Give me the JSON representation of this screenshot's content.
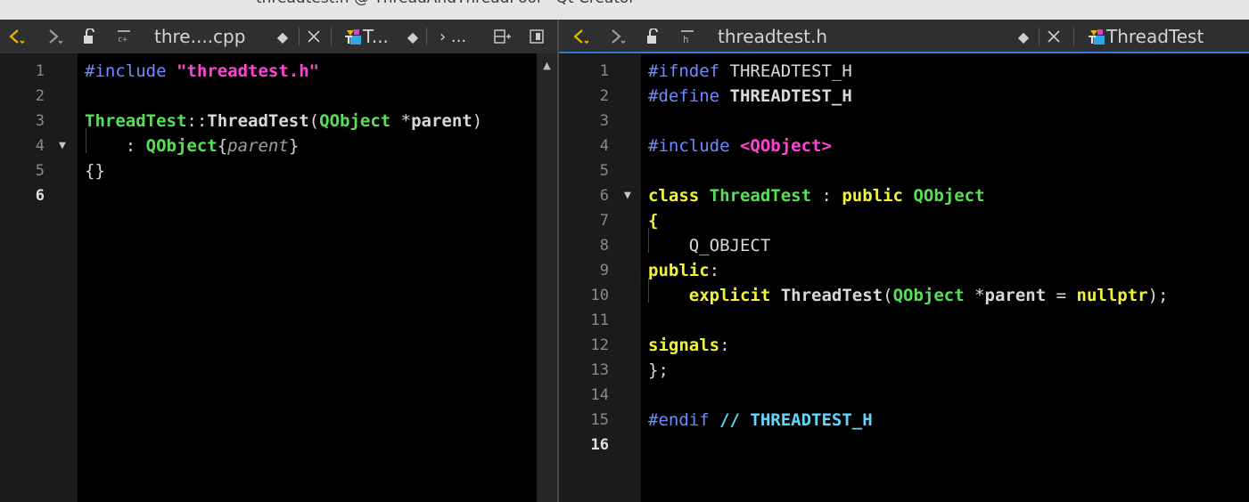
{
  "window": {
    "title": "threadtest.h @ ThreadAndThreadPool - Qt Creator"
  },
  "left_pane": {
    "toolbar": {
      "back_label": "⟨",
      "forward_label": "⟩",
      "file_name": "thre....cpp",
      "symbol_label": "T...",
      "breadcrumb_label": "› ...",
      "split_label": "⊞",
      "close_label": "✕"
    },
    "lines": [
      {
        "num": "1",
        "tokens": [
          {
            "c": "kw-pre",
            "t": "#include "
          },
          {
            "c": "kw-str",
            "t": "\"threadtest.h\""
          }
        ]
      },
      {
        "num": "2",
        "tokens": []
      },
      {
        "num": "3",
        "tokens": [
          {
            "c": "kw-type",
            "t": "ThreadTest"
          },
          {
            "c": "kw-op",
            "t": "::"
          },
          {
            "c": "kw-cls",
            "t": "ThreadTest"
          },
          {
            "c": "kw-op",
            "t": "("
          },
          {
            "c": "kw-type",
            "t": "QObject"
          },
          {
            "c": "kw-op",
            "t": " *"
          },
          {
            "c": "kw-cls",
            "t": "parent"
          },
          {
            "c": "kw-op",
            "t": ")"
          }
        ]
      },
      {
        "num": "4",
        "tokens": [
          {
            "c": "kw-op",
            "t": "    : "
          },
          {
            "c": "kw-type",
            "t": "QObject"
          },
          {
            "c": "kw-op",
            "t": "{"
          },
          {
            "c": "kw-ital",
            "t": "parent"
          },
          {
            "c": "kw-op",
            "t": "}"
          }
        ]
      },
      {
        "num": "5",
        "tokens": [
          {
            "c": "kw-op",
            "t": "{}"
          }
        ]
      },
      {
        "num": "6",
        "tokens": []
      }
    ]
  },
  "right_pane": {
    "toolbar": {
      "back_label": "⟨",
      "forward_label": "⟩",
      "file_name": "threadtest.h",
      "symbol_label": "ThreadTest",
      "close_label": "✕"
    },
    "lines": [
      {
        "num": "1",
        "tokens": [
          {
            "c": "kw-pre",
            "t": "#ifndef "
          },
          {
            "c": "kw-mac",
            "t": "THREADTEST_H"
          }
        ]
      },
      {
        "num": "2",
        "tokens": [
          {
            "c": "kw-pre",
            "t": "#define "
          },
          {
            "c": "kw-macb",
            "t": "THREADTEST_H"
          }
        ]
      },
      {
        "num": "3",
        "tokens": []
      },
      {
        "num": "4",
        "tokens": [
          {
            "c": "kw-pre",
            "t": "#include "
          },
          {
            "c": "kw-str",
            "t": "<QObject>"
          }
        ]
      },
      {
        "num": "5",
        "tokens": []
      },
      {
        "num": "6",
        "tokens": [
          {
            "c": "kw-key",
            "t": "class "
          },
          {
            "c": "kw-type",
            "t": "ThreadTest"
          },
          {
            "c": "kw-op",
            "t": " : "
          },
          {
            "c": "kw-key",
            "t": "public "
          },
          {
            "c": "kw-type",
            "t": "QObject"
          }
        ]
      },
      {
        "num": "7",
        "tokens": [
          {
            "c": "kw-key",
            "t": "{"
          }
        ]
      },
      {
        "num": "8",
        "tokens": [
          {
            "c": "kw-mac",
            "t": "    Q_OBJECT"
          }
        ]
      },
      {
        "num": "9",
        "tokens": [
          {
            "c": "kw-key",
            "t": "public"
          },
          {
            "c": "kw-op",
            "t": ":"
          }
        ]
      },
      {
        "num": "10",
        "tokens": [
          {
            "c": "kw-op",
            "t": "    "
          },
          {
            "c": "kw-key",
            "t": "explicit "
          },
          {
            "c": "kw-cls",
            "t": "ThreadTest"
          },
          {
            "c": "kw-op",
            "t": "("
          },
          {
            "c": "kw-type",
            "t": "QObject"
          },
          {
            "c": "kw-op",
            "t": " *"
          },
          {
            "c": "kw-cls",
            "t": "parent"
          },
          {
            "c": "kw-op",
            "t": " = "
          },
          {
            "c": "kw-key",
            "t": "nullptr"
          },
          {
            "c": "kw-op",
            "t": ");"
          }
        ]
      },
      {
        "num": "11",
        "tokens": []
      },
      {
        "num": "12",
        "tokens": [
          {
            "c": "kw-key",
            "t": "signals"
          },
          {
            "c": "kw-op",
            "t": ":"
          }
        ]
      },
      {
        "num": "13",
        "tokens": [
          {
            "c": "kw-op",
            "t": "};"
          }
        ]
      },
      {
        "num": "14",
        "tokens": []
      },
      {
        "num": "15",
        "tokens": [
          {
            "c": "kw-pre",
            "t": "#endif "
          },
          {
            "c": "kw-cm",
            "t": "// THREADTEST_H"
          }
        ]
      },
      {
        "num": "16",
        "tokens": []
      }
    ]
  },
  "colors": {
    "editor_bg": "#000000",
    "gutter_bg": "#1b1b1b",
    "preprocessor": "#6d8cff",
    "string": "#ff44d4",
    "type": "#57e057",
    "keyword": "#f2f23a",
    "comment": "#5fd7ff",
    "active_tab_underline": "#2e7bd6",
    "nav_back": "#e8b800"
  }
}
